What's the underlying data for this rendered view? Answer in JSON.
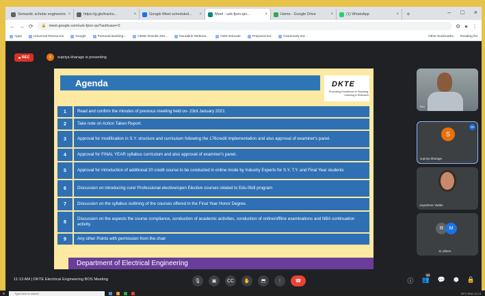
{
  "browser": {
    "tabs": [
      {
        "label": "Semantic scholar engineering...",
        "active": false
      },
      {
        "label": "https://g.gle/tracks...",
        "active": false
      },
      {
        "label": "Google Meet scheduled...",
        "active": false
      },
      {
        "label": "Meet - uzk-fpxn-qvi...",
        "active": true
      },
      {
        "label": "Home - Google Drive",
        "active": false
      },
      {
        "label": "(1) WhatsApp",
        "active": false
      }
    ],
    "url": "meet.google.com/uzk-fpxn-qvi?authuser=2",
    "bookmarks": [
      "Apps",
      "Universal Resources",
      "Google",
      "Personal Banking...",
      "CBSE Results 202...",
      "Neuralink Webinar...",
      "AWS Educate",
      "Prepared Ed.",
      "Grammarly Ed..."
    ],
    "bookmarks_right": [
      "Other bookmarks",
      "Reading list"
    ]
  },
  "meet": {
    "rec_label": "REC",
    "presenting": "supriya kharage is presenting",
    "presenter_initial": "S"
  },
  "slide": {
    "heading": "Agenda",
    "logo_title": "DKTE",
    "logo_tagline": "Promoting Excellence in Teaching, Learning & Research",
    "items": [
      {
        "num": "1",
        "text": "Read and confirm the minutes of previous meeting held on- 23rd January 2021"
      },
      {
        "num": "2",
        "text": "Take note on Action Taken Report."
      },
      {
        "num": "3",
        "text": "Approval for modification in S.Y. structure and curriculum following the 176credit implementation and also approval of examiner's panel."
      },
      {
        "num": "4",
        "text": "Approval for FINAL YEAR syllabus curriculum and also approval of examiner's panel.."
      },
      {
        "num": "5",
        "text": "Approval for introduction of additional 20 credit course to be conducted in online mode by Industry Experts for S.Y, T.Y. and Final Year students"
      },
      {
        "num": "6",
        "text": "Discussion on introducing core/ Professional elective/open Elective courses related to Edu-Skill program"
      },
      {
        "num": "7",
        "text": "Discussion on the syllabus outlining of the courses offered in the Final Year Honor Degree."
      },
      {
        "num": "8",
        "text": "Discussion on the aspects the course compliance, conduction of academic activities, conduction of online/offline examinations and NBA continuation activity."
      },
      {
        "num": "9",
        "text": "Any other Points with permission from the chair"
      }
    ],
    "footer": "Department of Electrical Engineering"
  },
  "participants": [
    {
      "name": "You"
    },
    {
      "name": "supriya kharage",
      "initial": "S"
    },
    {
      "name": "Jayashree Vadde"
    },
    {
      "name": "11 others",
      "initials": [
        "R",
        "M"
      ]
    }
  ],
  "bottom": {
    "time": "11:13 AM",
    "meeting_title": "DKTE Electrical Engineering BOS Meeting",
    "people_count": "14"
  },
  "taskbar": {
    "search_placeholder": "Type here to search",
    "tray": "29°C  ENG  11:13"
  },
  "colors": {
    "slide_bg": "#fde9a2",
    "item_blue": "#2f6fb3",
    "footer_purple": "#6a3d9a",
    "end_call_red": "#ea4335",
    "rec_red": "#d93025"
  }
}
